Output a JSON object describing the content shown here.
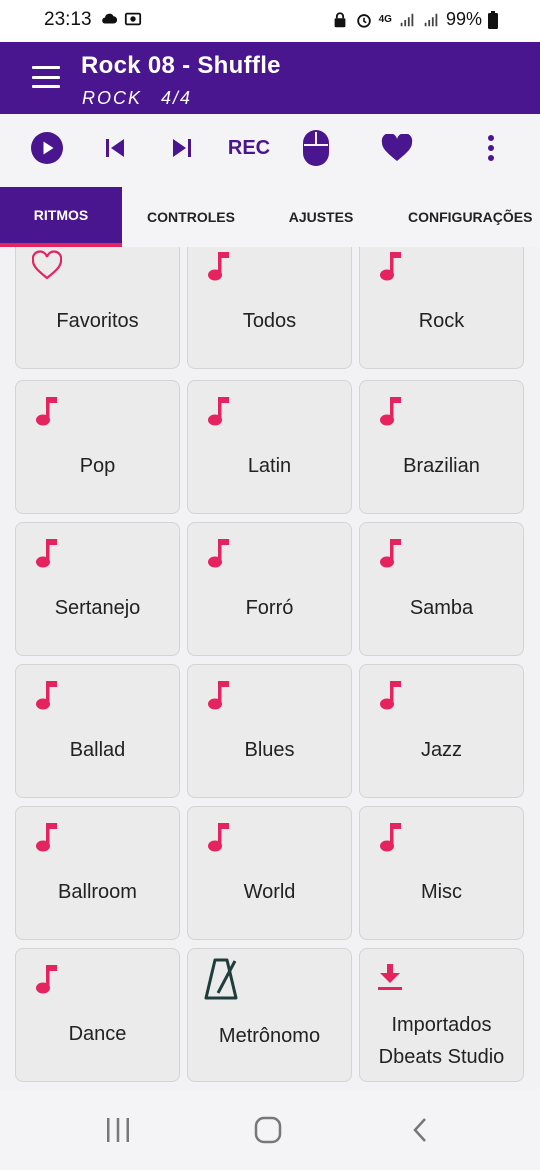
{
  "status_bar": {
    "time": "23:13",
    "network": "4G",
    "battery": "99%"
  },
  "header": {
    "title": "Rock 08 - Shuffle",
    "subtitle": "ROCK   4/4"
  },
  "toolbar": {
    "rec_label": "REC"
  },
  "tabs": [
    {
      "label": "RITMOS",
      "active": true
    },
    {
      "label": "CONTROLES",
      "active": false
    },
    {
      "label": "AJUSTES",
      "active": false
    },
    {
      "label": "CONFIGURAÇÕES",
      "active": false
    }
  ],
  "grid": {
    "items": [
      {
        "label": "Favoritos",
        "icon": "heart-outline-icon"
      },
      {
        "label": "Todos",
        "icon": "music-note-icon"
      },
      {
        "label": "Rock",
        "icon": "music-note-icon"
      },
      {
        "label": "Pop",
        "icon": "music-note-icon"
      },
      {
        "label": "Latin",
        "icon": "music-note-icon"
      },
      {
        "label": "Brazilian",
        "icon": "music-note-icon"
      },
      {
        "label": "Sertanejo",
        "icon": "music-note-icon"
      },
      {
        "label": "Forró",
        "icon": "music-note-icon"
      },
      {
        "label": "Samba",
        "icon": "music-note-icon"
      },
      {
        "label": "Ballad",
        "icon": "music-note-icon"
      },
      {
        "label": "Blues",
        "icon": "music-note-icon"
      },
      {
        "label": "Jazz",
        "icon": "music-note-icon"
      },
      {
        "label": "Ballroom",
        "icon": "music-note-icon"
      },
      {
        "label": "World",
        "icon": "music-note-icon"
      },
      {
        "label": "Misc",
        "icon": "music-note-icon"
      },
      {
        "label": "Dance",
        "icon": "music-note-icon"
      },
      {
        "label": "Metrônomo",
        "icon": "metronome-icon"
      },
      {
        "label": "Importados\nDbeats Studio",
        "line1": "Importados",
        "line2": "Dbeats Studio",
        "icon": "download-icon"
      }
    ]
  },
  "colors": {
    "primary": "#4a1690",
    "accent": "#e4235f",
    "background": "#f2f2f4",
    "cell": "#ebebeb"
  }
}
